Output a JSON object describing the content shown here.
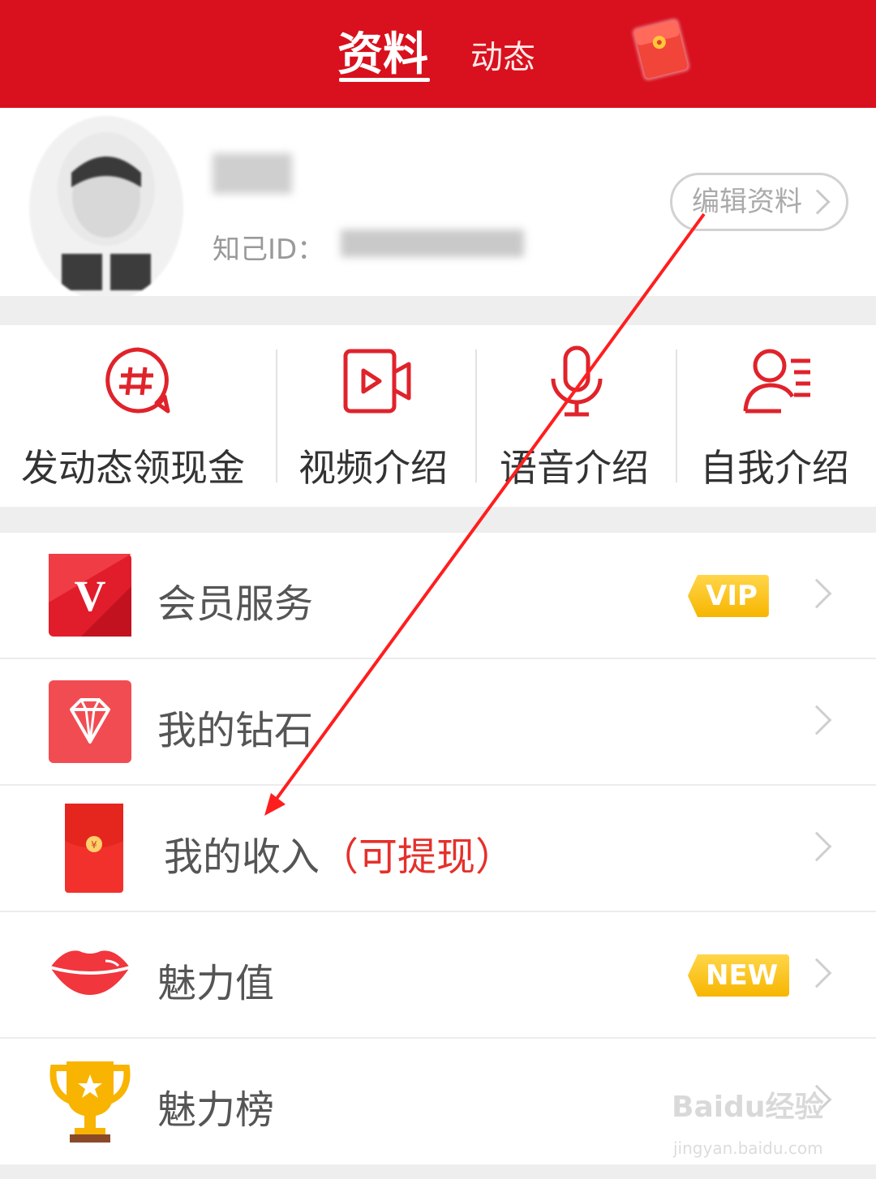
{
  "header": {
    "tabs": [
      {
        "label": "资料",
        "active": true
      },
      {
        "label": "动态",
        "active": false
      }
    ],
    "accent_color": "#d9101d"
  },
  "profile": {
    "id_label": "知己ID：",
    "edit_button": "编辑资料"
  },
  "actions": [
    {
      "label": "发动态领现金",
      "icon": "hashtag-bubble-icon"
    },
    {
      "label": "视频介绍",
      "icon": "video-camera-icon"
    },
    {
      "label": "语音介绍",
      "icon": "microphone-icon"
    },
    {
      "label": "自我介绍",
      "icon": "user-list-icon"
    }
  ],
  "menu": [
    {
      "label": "会员服务",
      "icon": "vip-v-icon",
      "badge": "VIP"
    },
    {
      "label": "我的钻石",
      "icon": "diamond-icon"
    },
    {
      "label": "我的收入",
      "label_accent": "（可提现）",
      "icon": "red-envelope-icon"
    },
    {
      "label": "魅力值",
      "icon": "lips-icon",
      "badge": "NEW"
    },
    {
      "label": "魅力榜",
      "icon": "trophy-icon"
    }
  ],
  "watermark": {
    "brand": "Baidu经验",
    "url": "jingyan.baidu.com"
  }
}
